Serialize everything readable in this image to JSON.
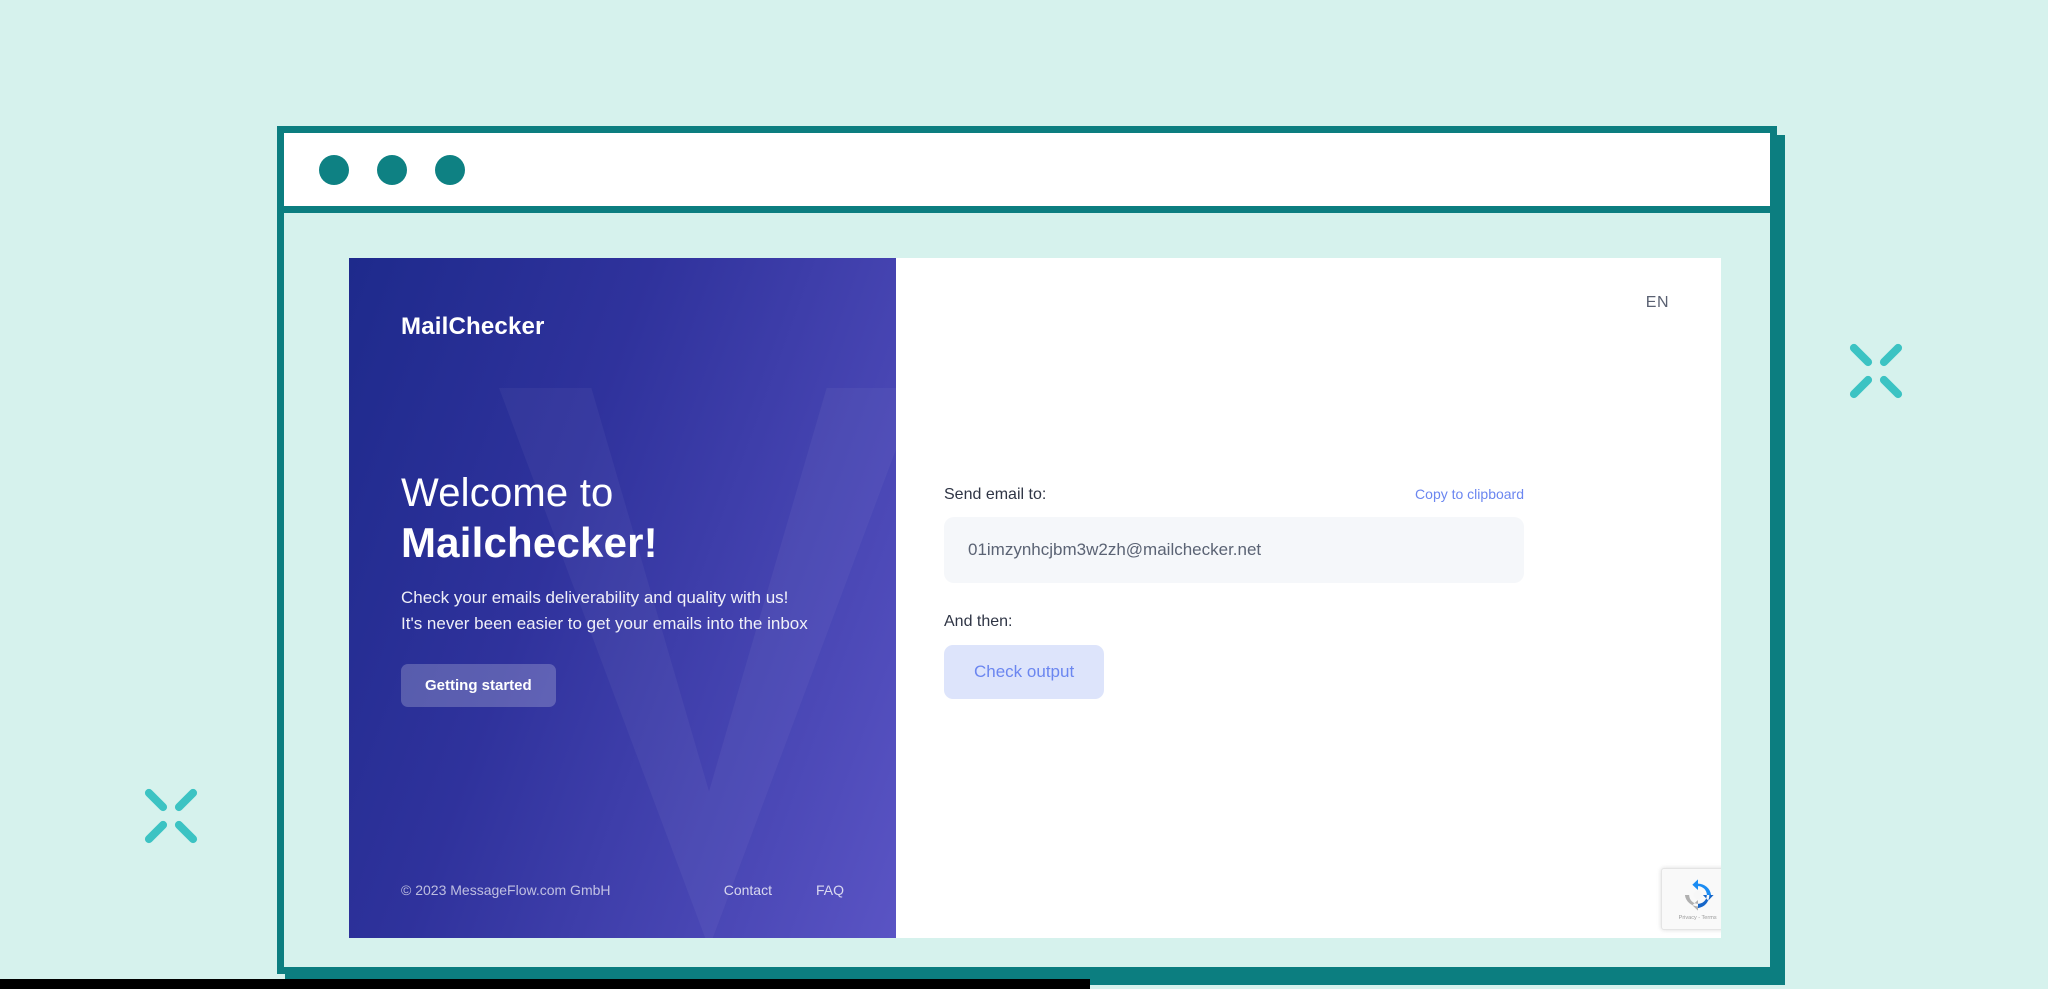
{
  "window": {
    "dots": [
      "window-dot-1",
      "window-dot-2",
      "window-dot-3"
    ]
  },
  "hero": {
    "brand": "MailChecker",
    "headline_line1": "Welcome to",
    "headline_line2": "Mailchecker!",
    "subtitle_line1": "Check your emails deliverability and quality with us!",
    "subtitle_line2": "It's never been easier to get your emails into the inbox",
    "cta_label": "Getting started",
    "copyright": "© 2023 MessageFlow.com GmbH",
    "links": [
      {
        "label": "Contact"
      },
      {
        "label": "FAQ"
      }
    ]
  },
  "content": {
    "language": "EN",
    "send_email_label": "Send email to:",
    "copy_to_clipboard_label": "Copy to clipboard",
    "email_address": "01imzynhcjbm3w2zh@mailchecker.net",
    "and_then_label": "And then:",
    "check_output_label": "Check output",
    "recaptcha_legal": "Privacy - Terms"
  },
  "colors": {
    "page_background": "#d6f2ed",
    "browser_border": "#0c7e80",
    "window_dot": "#0e8183",
    "sparkle": "#3cc3c3",
    "hero_gradient_start": "#1e2a8c",
    "hero_gradient_end": "#5a54c4",
    "accent_link": "#6b86f0",
    "button_background": "#dde4fb",
    "email_box_background": "#f5f7fa"
  }
}
